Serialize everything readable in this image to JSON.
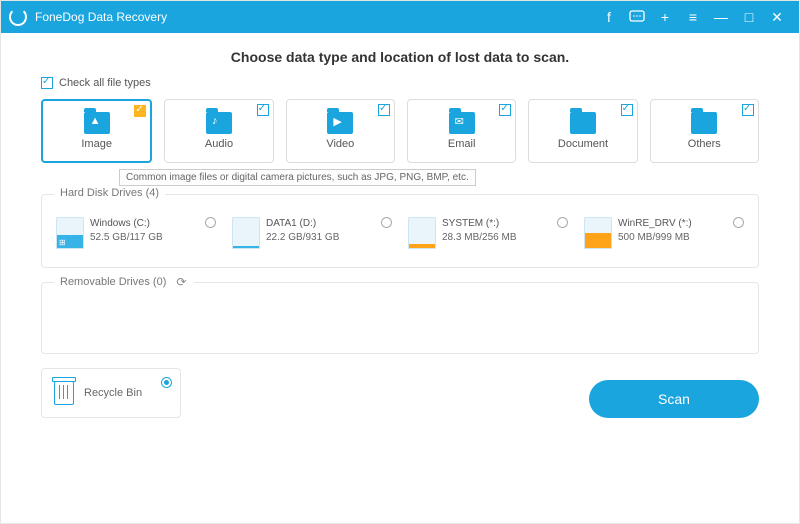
{
  "titlebar": {
    "title": "FoneDog Data Recovery"
  },
  "heading": "Choose data type and location of lost data to scan.",
  "checkall_label": "Check all file types",
  "types": [
    {
      "label": "Image",
      "selected": true,
      "glyph": "▲"
    },
    {
      "label": "Audio",
      "selected": false,
      "glyph": "♪"
    },
    {
      "label": "Video",
      "selected": false,
      "glyph": "▶"
    },
    {
      "label": "Email",
      "selected": false,
      "glyph": "✉"
    },
    {
      "label": "Document",
      "selected": false,
      "glyph": ""
    },
    {
      "label": "Others",
      "selected": false,
      "glyph": ""
    }
  ],
  "tooltip": "Common image files or digital camera pictures, such as JPG, PNG, BMP, etc.",
  "hdd_title": "Hard Disk Drives (4)",
  "drives": [
    {
      "name": "Windows (C:)",
      "size": "52.5 GB/117 GB",
      "fill_pct": 45,
      "sys": false,
      "win": true
    },
    {
      "name": "DATA1 (D:)",
      "size": "22.2 GB/931 GB",
      "fill_pct": 6,
      "sys": false,
      "win": false
    },
    {
      "name": "SYSTEM (*:)",
      "size": "28.3 MB/256 MB",
      "fill_pct": 12,
      "sys": true,
      "win": false
    },
    {
      "name": "WinRE_DRV (*:)",
      "size": "500 MB/999 MB",
      "fill_pct": 50,
      "sys": true,
      "win": false
    }
  ],
  "removable_title": "Removable Drives (0)",
  "recycle_label": "Recycle Bin",
  "scan_label": "Scan"
}
